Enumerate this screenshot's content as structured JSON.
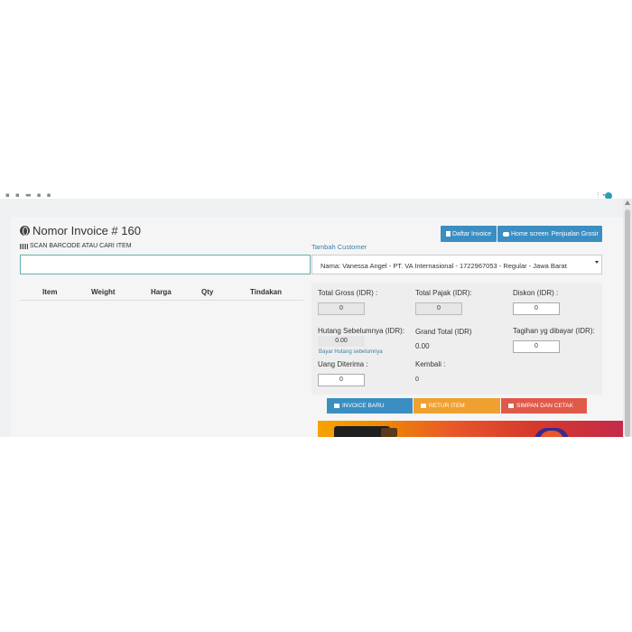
{
  "header": {
    "title": "Nomor Invoice # 160",
    "buttons": {
      "daftar_invoice": "Daftar Invoice",
      "home_screen": "Home screen",
      "penjualan_grosir": "Penjualan Grosir"
    }
  },
  "scan": {
    "label": "SCAN BARCODE ATAU CARI ITEM",
    "value": ""
  },
  "customer": {
    "link": "Tambah Customer",
    "selected": "Nama: Vanessa Angel - PT. VA Internasional - 1722967053 - Regular - Jawa Barat"
  },
  "table": {
    "columns": [
      "Item",
      "Weight",
      "Harga",
      "Qty",
      "Tindakan"
    ]
  },
  "summary": {
    "total_gross_label": "Total Gross (IDR) :",
    "total_gross_value": "0",
    "total_pajak_label": "Total Pajak (IDR):",
    "total_pajak_value": "0",
    "diskon_label": "Diskon (IDR) :",
    "diskon_value": "0",
    "hutang_label": "Hutang Sebelumnya (IDR):",
    "hutang_value": "0.00",
    "bayar_hutang": "Bayar Hutang sebelumnya",
    "grand_total_label": "Grand Total (IDR)",
    "grand_total_value": "0.00",
    "tagihan_label": "Tagihan yg dibayar (IDR):",
    "tagihan_value": "0",
    "uang_diterima_label": "Uang Diterima :",
    "uang_diterima_value": "0",
    "kembali_label": "Kembali :",
    "kembali_value": "0"
  },
  "actions": {
    "invoice_baru": "INVOICE BARU",
    "retur_item": "RETUR ITEM",
    "simpan_cetak": "SIMPAN DAN CETAK"
  },
  "colors": {
    "primary": "#3b8ec2",
    "warning": "#f0a030",
    "danger": "#e05a4a",
    "link": "#3a7fa8"
  }
}
